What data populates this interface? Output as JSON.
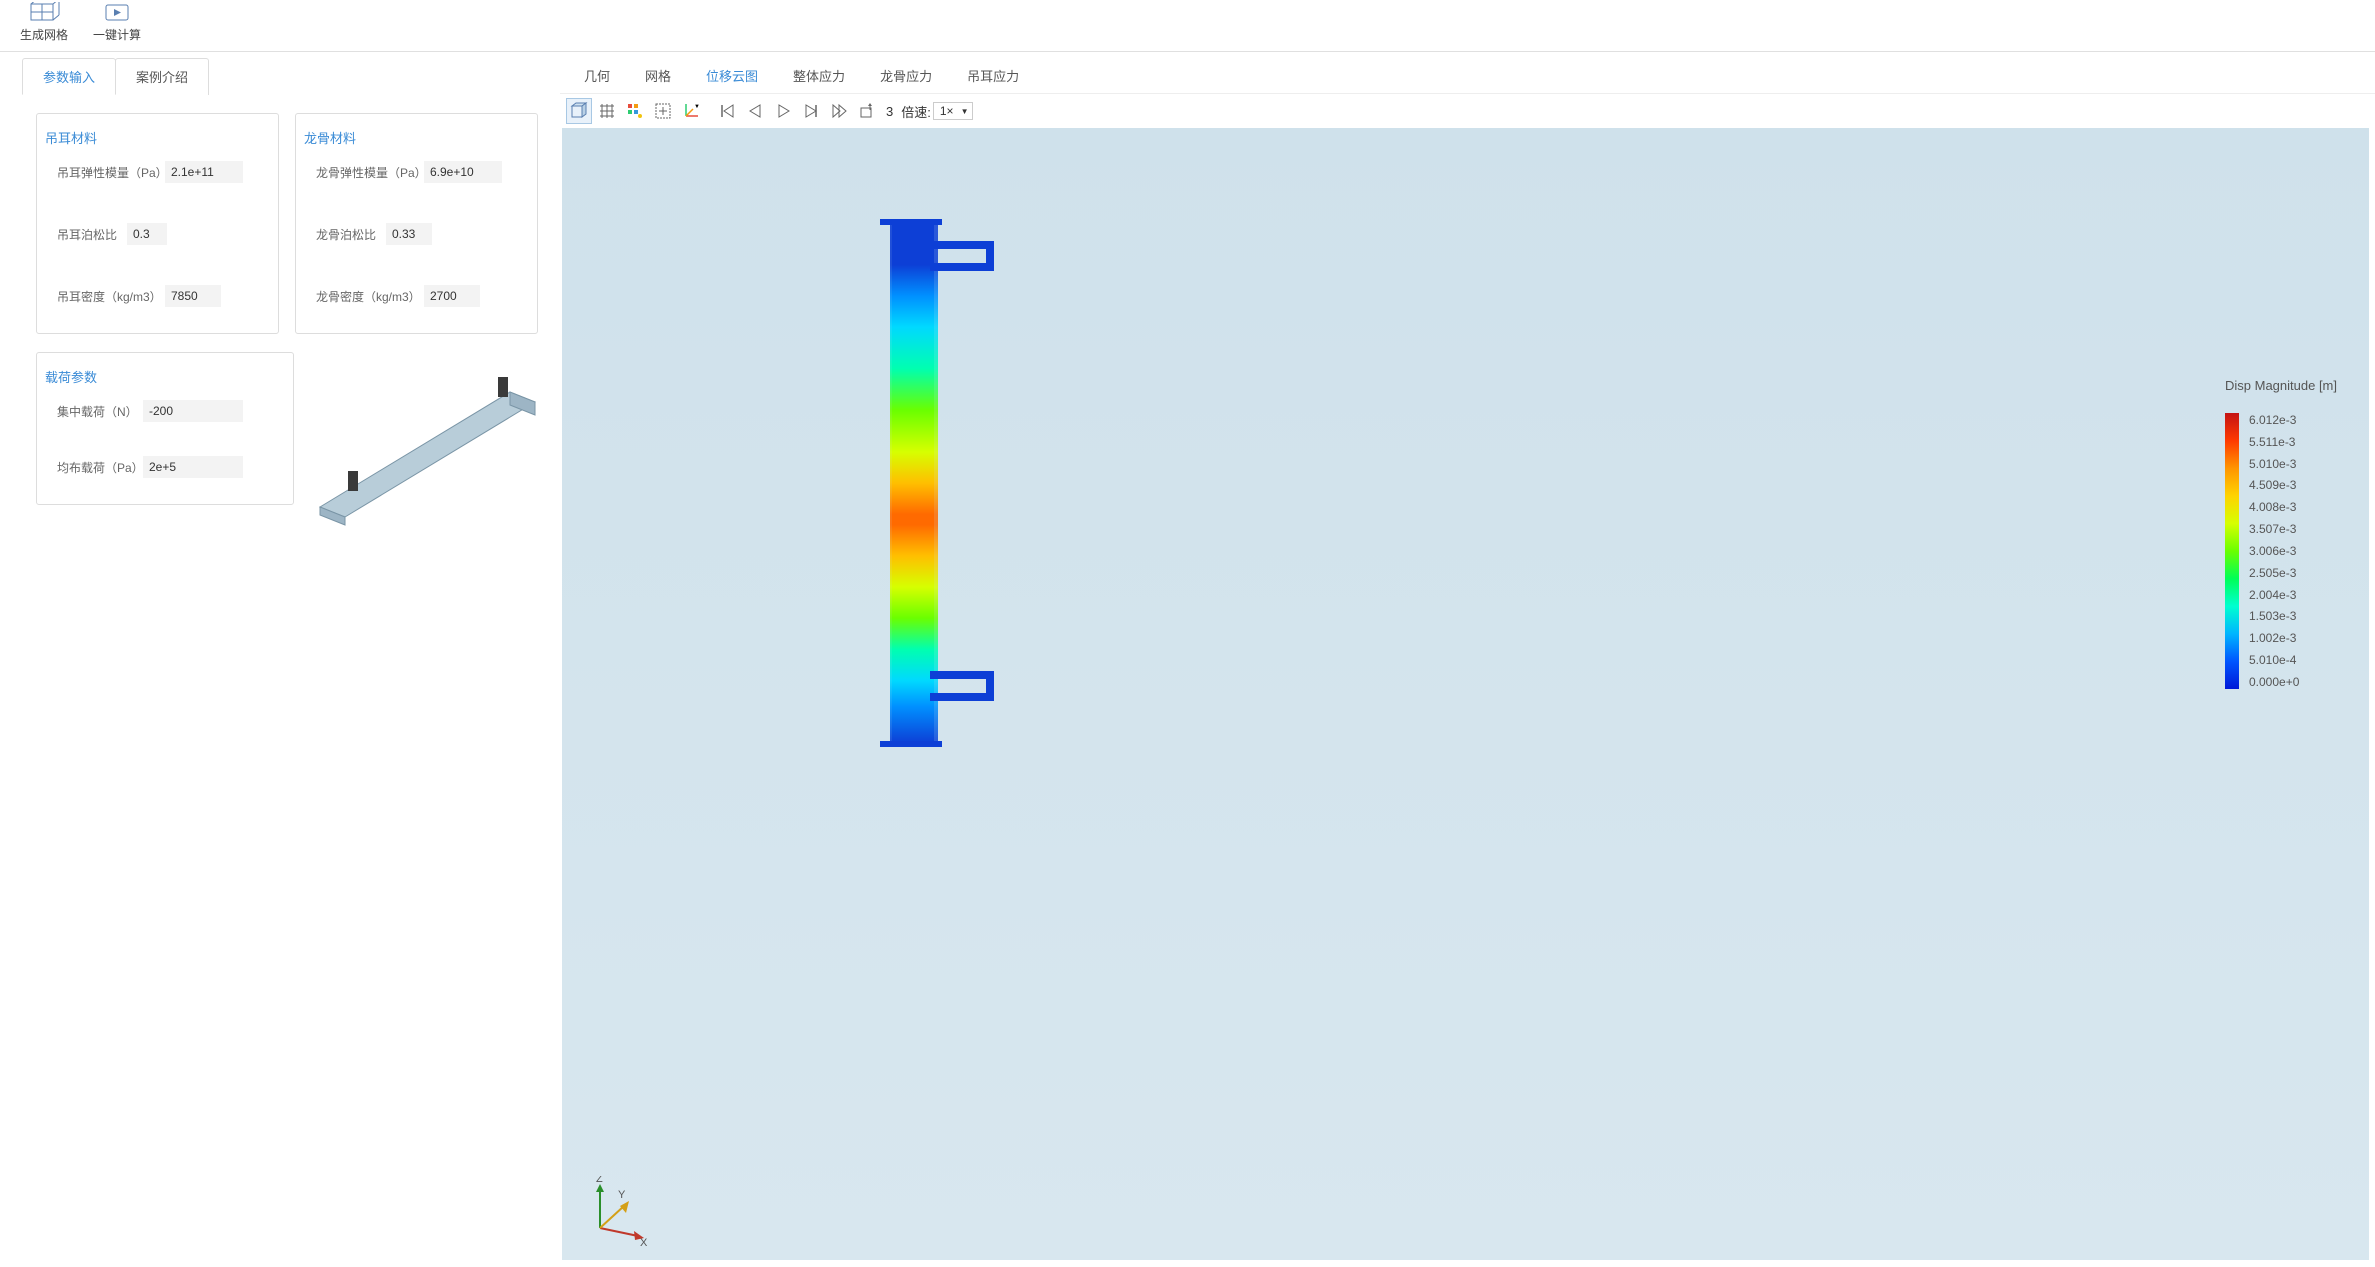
{
  "toolbar": {
    "mesh_btn": "生成网格",
    "calc_btn": "一键计算"
  },
  "left_tabs": {
    "params": "参数输入",
    "case": "案例介绍"
  },
  "right_tabs": {
    "geometry": "几何",
    "mesh": "网格",
    "displacement": "位移云图",
    "overall_stress": "整体应力",
    "keel_stress": "龙骨应力",
    "lug_stress": "吊耳应力"
  },
  "lug_material": {
    "title": "吊耳材料",
    "modulus_label": "吊耳弹性模量（Pa）",
    "modulus": "2.1e+11",
    "poisson_label": "吊耳泊松比",
    "poisson": "0.3",
    "density_label": "吊耳密度（kg/m3）",
    "density": "7850"
  },
  "keel_material": {
    "title": "龙骨材料",
    "modulus_label": "龙骨弹性模量（Pa）",
    "modulus": "6.9e+10",
    "poisson_label": "龙骨泊松比",
    "poisson": "0.33",
    "density_label": "龙骨密度（kg/m3）",
    "density": "2700"
  },
  "load": {
    "title": "载荷参数",
    "point_label": "集中载荷（N）",
    "point": "-200",
    "dist_label": "均布载荷（Pa）",
    "dist": "2e+5"
  },
  "playback": {
    "frame": "3",
    "speed_label": "倍速:",
    "speed_value": "1×"
  },
  "legend": {
    "title": "Disp Magnitude [m]",
    "ticks": [
      "6.012e-3",
      "5.511e-3",
      "5.010e-3",
      "4.509e-3",
      "4.008e-3",
      "3.507e-3",
      "3.006e-3",
      "2.505e-3",
      "2.004e-3",
      "1.503e-3",
      "1.002e-3",
      "5.010e-4",
      "0.000e+0"
    ]
  },
  "axes": {
    "x": "X",
    "y": "Y",
    "z": "Z"
  }
}
